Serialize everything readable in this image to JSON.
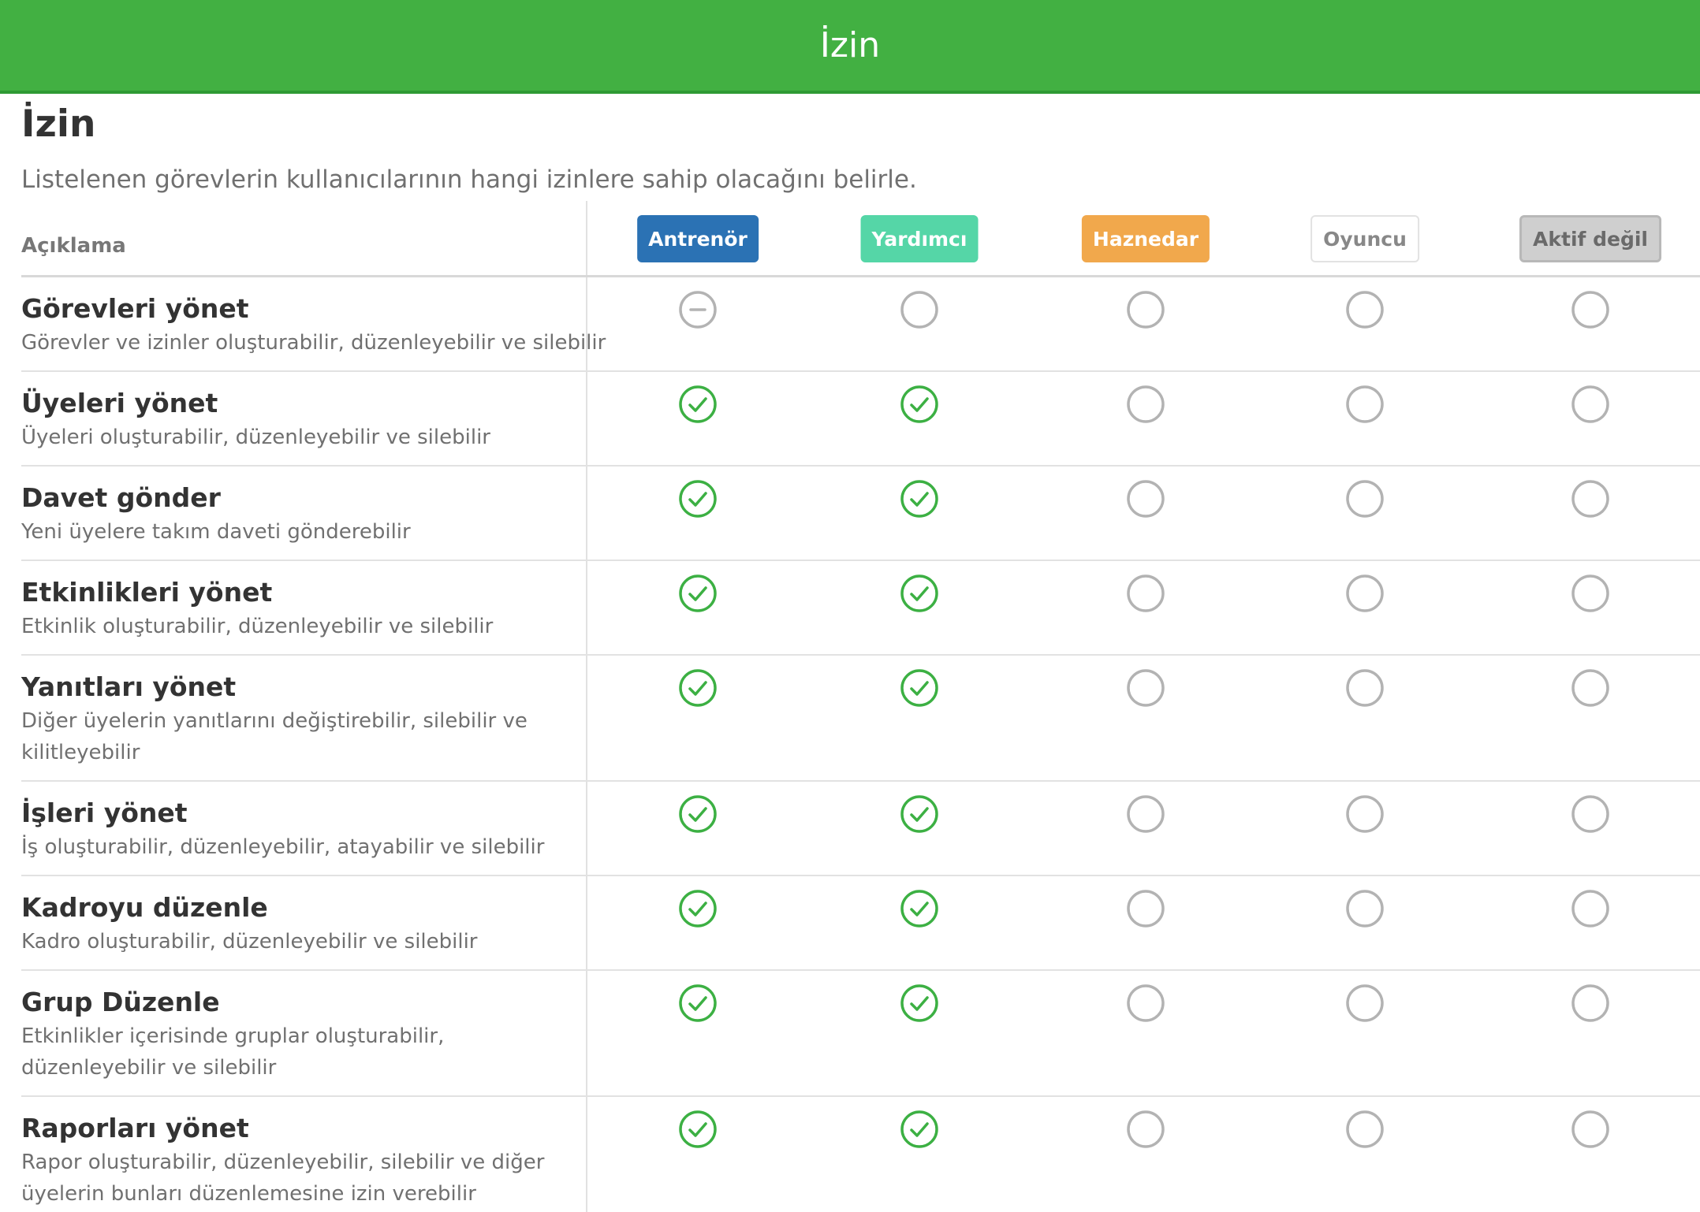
{
  "header": {
    "title": "İzin"
  },
  "page": {
    "title": "İzin",
    "description": "Listelenen görevlerin kullanıcılarının hangi izinlere sahip olacağını belirle."
  },
  "table": {
    "description_header": "Açıklama",
    "roles": [
      {
        "label": "Antrenör",
        "color": "#2b72b4"
      },
      {
        "label": "Yardımcı",
        "color": "#55d6a7"
      },
      {
        "label": "Haznedar",
        "color": "#f1a84c"
      },
      {
        "label": "Oyuncu",
        "color": "#ffffff"
      },
      {
        "label": "Aktif değil",
        "color": "#cfcfcf"
      }
    ],
    "rows": [
      {
        "title": "Görevleri yönet",
        "description": "Görevler ve izinler oluşturabilir, düzenleyebilir ve silebilir",
        "states": [
          "disabled",
          "off",
          "off",
          "off",
          "off"
        ]
      },
      {
        "title": "Üyeleri yönet",
        "description": "Üyeleri oluşturabilir, düzenleyebilir ve silebilir",
        "states": [
          "on",
          "on",
          "off",
          "off",
          "off"
        ]
      },
      {
        "title": "Davet gönder",
        "description": "Yeni üyelere takım daveti gönderebilir",
        "states": [
          "on",
          "on",
          "off",
          "off",
          "off"
        ]
      },
      {
        "title": "Etkinlikleri yönet",
        "description": "Etkinlik oluşturabilir, düzenleyebilir ve silebilir",
        "states": [
          "on",
          "on",
          "off",
          "off",
          "off"
        ]
      },
      {
        "title": "Yanıtları yönet",
        "description": "Diğer üyelerin yanıtlarını değiştirebilir, silebilir ve kilitleyebilir",
        "states": [
          "on",
          "on",
          "off",
          "off",
          "off"
        ]
      },
      {
        "title": "İşleri yönet",
        "description": "İş oluşturabilir, düzenleyebilir, atayabilir ve silebilir",
        "states": [
          "on",
          "on",
          "off",
          "off",
          "off"
        ]
      },
      {
        "title": "Kadroyu düzenle",
        "description": "Kadro oluşturabilir, düzenleyebilir ve silebilir",
        "states": [
          "on",
          "on",
          "off",
          "off",
          "off"
        ]
      },
      {
        "title": "Grup Düzenle",
        "description": "Etkinlikler içerisinde gruplar oluşturabilir, düzenleyebilir ve silebilir",
        "states": [
          "on",
          "on",
          "off",
          "off",
          "off"
        ]
      },
      {
        "title": "Raporları yönet",
        "description": "Rapor oluşturabilir, düzenleyebilir, silebilir ve diğer üyelerin bunları düzenlemesine izin verebilir",
        "states": [
          "on",
          "on",
          "off",
          "off",
          "off"
        ]
      }
    ]
  },
  "colors": {
    "header_green": "#42b042",
    "check_green": "#3cb043",
    "circle_grey": "#b3b3b3"
  }
}
